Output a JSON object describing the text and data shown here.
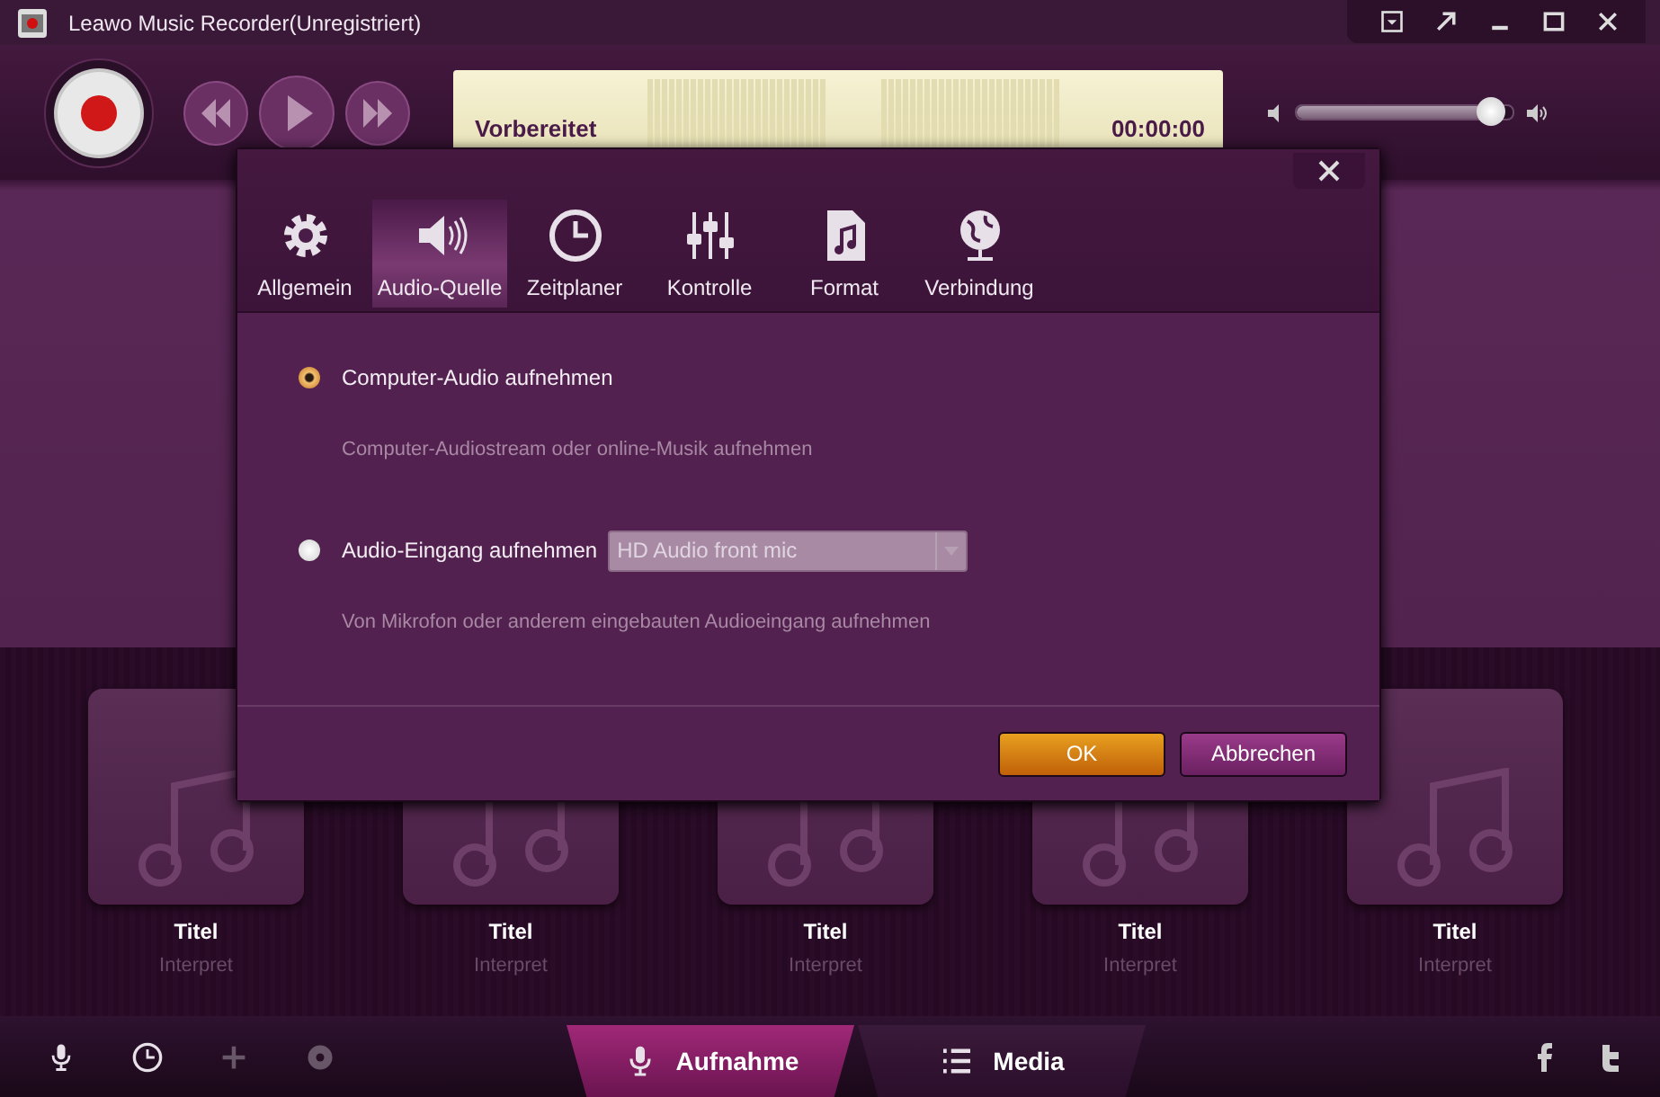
{
  "window": {
    "title": "Leawo Music Recorder(Unregistriert)"
  },
  "player": {
    "status": "Vorbereitet",
    "time": "00:00:00",
    "volume": {
      "level": 0.9
    }
  },
  "tracks": [
    {
      "title": "Titel",
      "artist": "Interpret"
    },
    {
      "title": "Titel",
      "artist": "Interpret"
    },
    {
      "title": "Titel",
      "artist": "Interpret"
    },
    {
      "title": "Titel",
      "artist": "Interpret"
    },
    {
      "title": "Titel",
      "artist": "Interpret"
    }
  ],
  "bottom_bar": {
    "tools": [
      {
        "kind": "mic",
        "disabled": false
      },
      {
        "kind": "clock",
        "disabled": false
      },
      {
        "kind": "add",
        "disabled": true
      },
      {
        "kind": "disc",
        "disabled": true
      }
    ],
    "tabs": [
      {
        "label": "Aufnahme",
        "kind": "mic",
        "selected": true
      },
      {
        "label": "Media",
        "kind": "list",
        "selected": false
      }
    ]
  },
  "dialog": {
    "tabs": [
      {
        "label": "Allgemein",
        "kind": "gear",
        "selected": false
      },
      {
        "label": "Audio-Quelle",
        "kind": "speaker",
        "selected": true
      },
      {
        "label": "Zeitplaner",
        "kind": "clock",
        "selected": false
      },
      {
        "label": "Kontrolle",
        "kind": "sliders",
        "selected": false
      },
      {
        "label": "Format",
        "kind": "file",
        "selected": false
      },
      {
        "label": "Verbindung",
        "kind": "globe",
        "selected": false
      }
    ],
    "options": [
      {
        "label": "Computer-Audio aufnehmen",
        "selected": true,
        "description": "Computer-Audiostream oder online-Musik aufnehmen"
      },
      {
        "label": "Audio-Eingang aufnehmen",
        "selected": false,
        "device": {
          "value": "HD Audio front mic",
          "disabled": true
        },
        "description": "Von Mikrofon oder anderem eingebauten Audioeingang aufnehmen"
      }
    ],
    "buttons": [
      {
        "label": "OK",
        "kind": "primary"
      },
      {
        "label": "Abbrechen",
        "kind": "secondary"
      }
    ]
  }
}
